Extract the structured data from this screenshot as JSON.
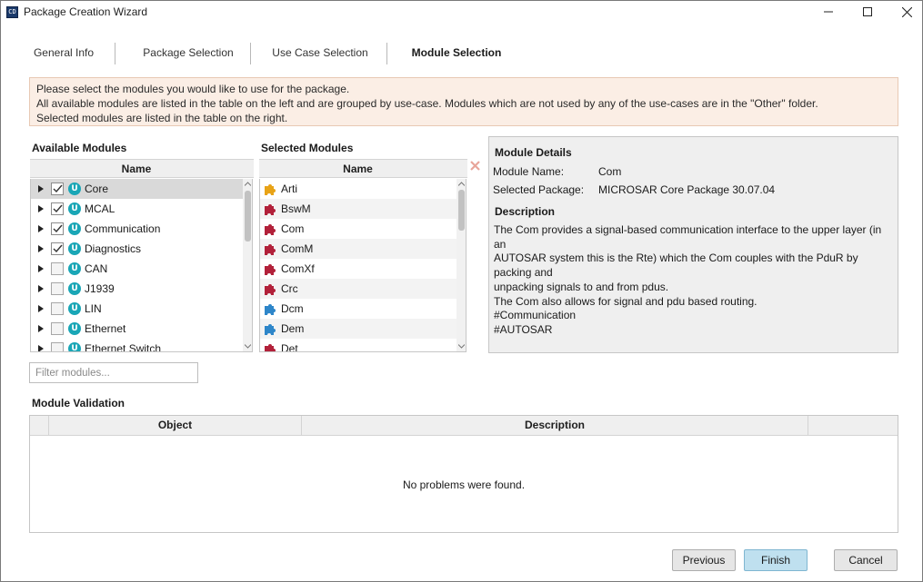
{
  "window": {
    "title": "Package Creation Wizard",
    "app_icon_text": "CD"
  },
  "tabs": [
    {
      "label": "General Info",
      "active": false
    },
    {
      "label": "Package Selection",
      "active": false
    },
    {
      "label": "Use Case Selection",
      "active": false
    },
    {
      "label": "Module Selection",
      "active": true
    }
  ],
  "info": {
    "line1": "Please select the modules you would like to use for the package.",
    "line2": "All available modules are listed in the table on the left and are grouped by use-case. Modules which are not used by any of the use-cases are in the \"Other\" folder.",
    "line3": "Selected modules are listed in the table on the right."
  },
  "available": {
    "title": "Available Modules",
    "column": "Name",
    "badge": "U",
    "items": [
      {
        "label": "Core",
        "checked": true
      },
      {
        "label": "MCAL",
        "checked": true
      },
      {
        "label": "Communication",
        "checked": true
      },
      {
        "label": "Diagnostics",
        "checked": true
      },
      {
        "label": "CAN",
        "checked": false
      },
      {
        "label": "J1939",
        "checked": false
      },
      {
        "label": "LIN",
        "checked": false
      },
      {
        "label": "Ethernet",
        "checked": false
      },
      {
        "label": "Ethernet Switch",
        "checked": false
      }
    ]
  },
  "selected": {
    "title": "Selected Modules",
    "column": "Name",
    "items": [
      {
        "label": "Arti",
        "icon": "puzzle-yellow-icon",
        "color": "#e8a317"
      },
      {
        "label": "BswM",
        "icon": "puzzle-red-icon",
        "color": "#b2213a"
      },
      {
        "label": "Com",
        "icon": "puzzle-red-icon",
        "color": "#b2213a"
      },
      {
        "label": "ComM",
        "icon": "puzzle-red-icon",
        "color": "#b2213a"
      },
      {
        "label": "ComXf",
        "icon": "puzzle-red-icon",
        "color": "#b2213a"
      },
      {
        "label": "Crc",
        "icon": "puzzle-red-icon",
        "color": "#b2213a"
      },
      {
        "label": "Dcm",
        "icon": "puzzle-blue-icon",
        "color": "#2e86c9"
      },
      {
        "label": "Dem",
        "icon": "puzzle-blue-icon",
        "color": "#2e86c9"
      },
      {
        "label": "Det",
        "icon": "puzzle-red-icon",
        "color": "#b2213a"
      }
    ]
  },
  "details": {
    "title": "Module Details",
    "name_label": "Module Name:",
    "name_value": "Com",
    "package_label": "Selected Package:",
    "package_value": "MICROSAR Core Package 30.07.04",
    "description_title": "Description",
    "description": [
      "The Com provides a signal-based communication interface to the upper layer (in an",
      "AUTOSAR system this is the Rte) which the Com couples with the PduR by packing and",
      "unpacking signals to and from pdus.",
      "The Com also allows for signal and pdu based routing.",
      "#Communication",
      "#AUTOSAR"
    ]
  },
  "filter": {
    "placeholder": "Filter modules...",
    "value": ""
  },
  "validation": {
    "title": "Module Validation",
    "columns": [
      "Object",
      "Description"
    ],
    "empty_text": "No problems were found."
  },
  "buttons": {
    "previous": "Previous",
    "finish": "Finish",
    "cancel": "Cancel"
  },
  "colors": {
    "info_bg": "#fbeee5",
    "badge": "#19a6b6",
    "finish_bg": "#bfe0ef"
  }
}
